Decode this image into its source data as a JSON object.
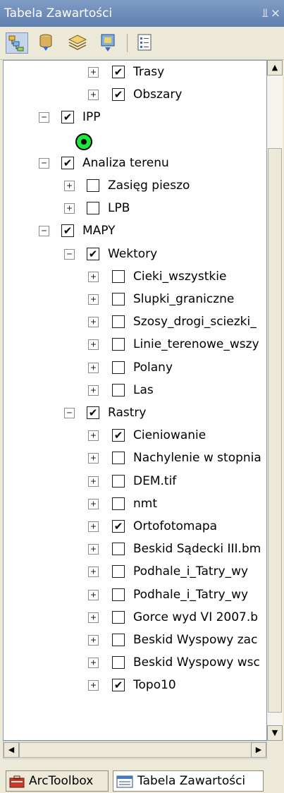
{
  "window": {
    "title": "Tabela Zawartości",
    "pin_glyph": "⫫",
    "close_glyph": "×"
  },
  "toolbar": {
    "buttons": [
      {
        "icon": "list-by-drawing-order-icon",
        "active": true
      },
      {
        "icon": "list-by-source-icon",
        "active": false
      },
      {
        "icon": "list-by-visibility-icon",
        "active": false
      },
      {
        "icon": "list-by-selection-icon",
        "active": false
      },
      {
        "icon": "options-icon",
        "active": false
      }
    ]
  },
  "tree": {
    "rows": [
      {
        "label": "Trasy",
        "level": 2,
        "expander": "+",
        "checked": true
      },
      {
        "label": "Obszary",
        "level": 2,
        "expander": "+",
        "checked": true
      },
      {
        "label": "IPP",
        "level": 0,
        "expander": "-",
        "checked": true
      },
      {
        "label": "",
        "level": 1,
        "symbol": "green-point-symbol"
      },
      {
        "label": "Analiza terenu",
        "level": 0,
        "expander": "-",
        "checked": true
      },
      {
        "label": "Zasięg pieszo",
        "level": 1,
        "expander": "+",
        "checked": false
      },
      {
        "label": "LPB",
        "level": 1,
        "expander": "+",
        "checked": false
      },
      {
        "label": "MAPY",
        "level": 0,
        "expander": "-",
        "checked": true
      },
      {
        "label": "Wektory",
        "level": 1,
        "expander": "-",
        "checked": true
      },
      {
        "label": "Cieki_wszystkie",
        "level": 2,
        "expander": "+",
        "checked": false
      },
      {
        "label": "Slupki_graniczne",
        "level": 2,
        "expander": "+",
        "checked": false
      },
      {
        "label": "Szosy_drogi_sciezki_",
        "level": 2,
        "expander": "+",
        "checked": false
      },
      {
        "label": "Linie_terenowe_wszy",
        "level": 2,
        "expander": "+",
        "checked": false
      },
      {
        "label": "Polany",
        "level": 2,
        "expander": "+",
        "checked": false
      },
      {
        "label": "Las",
        "level": 2,
        "expander": "+",
        "checked": false
      },
      {
        "label": "Rastry",
        "level": 1,
        "expander": "-",
        "checked": true
      },
      {
        "label": "Cieniowanie",
        "level": 2,
        "expander": "+",
        "checked": true
      },
      {
        "label": "Nachylenie w stopnia",
        "level": 2,
        "expander": "+",
        "checked": false
      },
      {
        "label": "DEM.tif",
        "level": 2,
        "expander": "+",
        "checked": false
      },
      {
        "label": "nmt",
        "level": 2,
        "expander": "+",
        "checked": false
      },
      {
        "label": "Ortofotomapa",
        "level": 2,
        "expander": "+",
        "checked": true
      },
      {
        "label": "Beskid Sądecki III.bm",
        "level": 2,
        "expander": "+",
        "checked": false
      },
      {
        "label": "Podhale_i_Tatry_wy",
        "level": 2,
        "expander": "+",
        "checked": false
      },
      {
        "label": "Podhale_i_Tatry_wy",
        "level": 2,
        "expander": "+",
        "checked": false
      },
      {
        "label": "Gorce wyd VI 2007.b",
        "level": 2,
        "expander": "+",
        "checked": false
      },
      {
        "label": "Beskid Wyspowy zac",
        "level": 2,
        "expander": "+",
        "checked": false
      },
      {
        "label": "Beskid Wyspowy wsc",
        "level": 2,
        "expander": "+",
        "checked": false
      },
      {
        "label": "Topo10",
        "level": 2,
        "expander": "+",
        "checked": true
      }
    ]
  },
  "scrollbars": {
    "up_glyph": "▲",
    "down_glyph": "▼",
    "left_glyph": "◀",
    "right_glyph": "▶"
  },
  "tabs": [
    {
      "label": "ArcToolbox",
      "icon": "arctoolbox-icon",
      "selected": false
    },
    {
      "label": "Tabela Zawartości",
      "icon": "table-of-contents-icon",
      "selected": true
    }
  ],
  "colors": {
    "titlebar": "#6f8db9",
    "symbol_fill": "#1ee63c",
    "panel_bg": "#ece9d8"
  }
}
